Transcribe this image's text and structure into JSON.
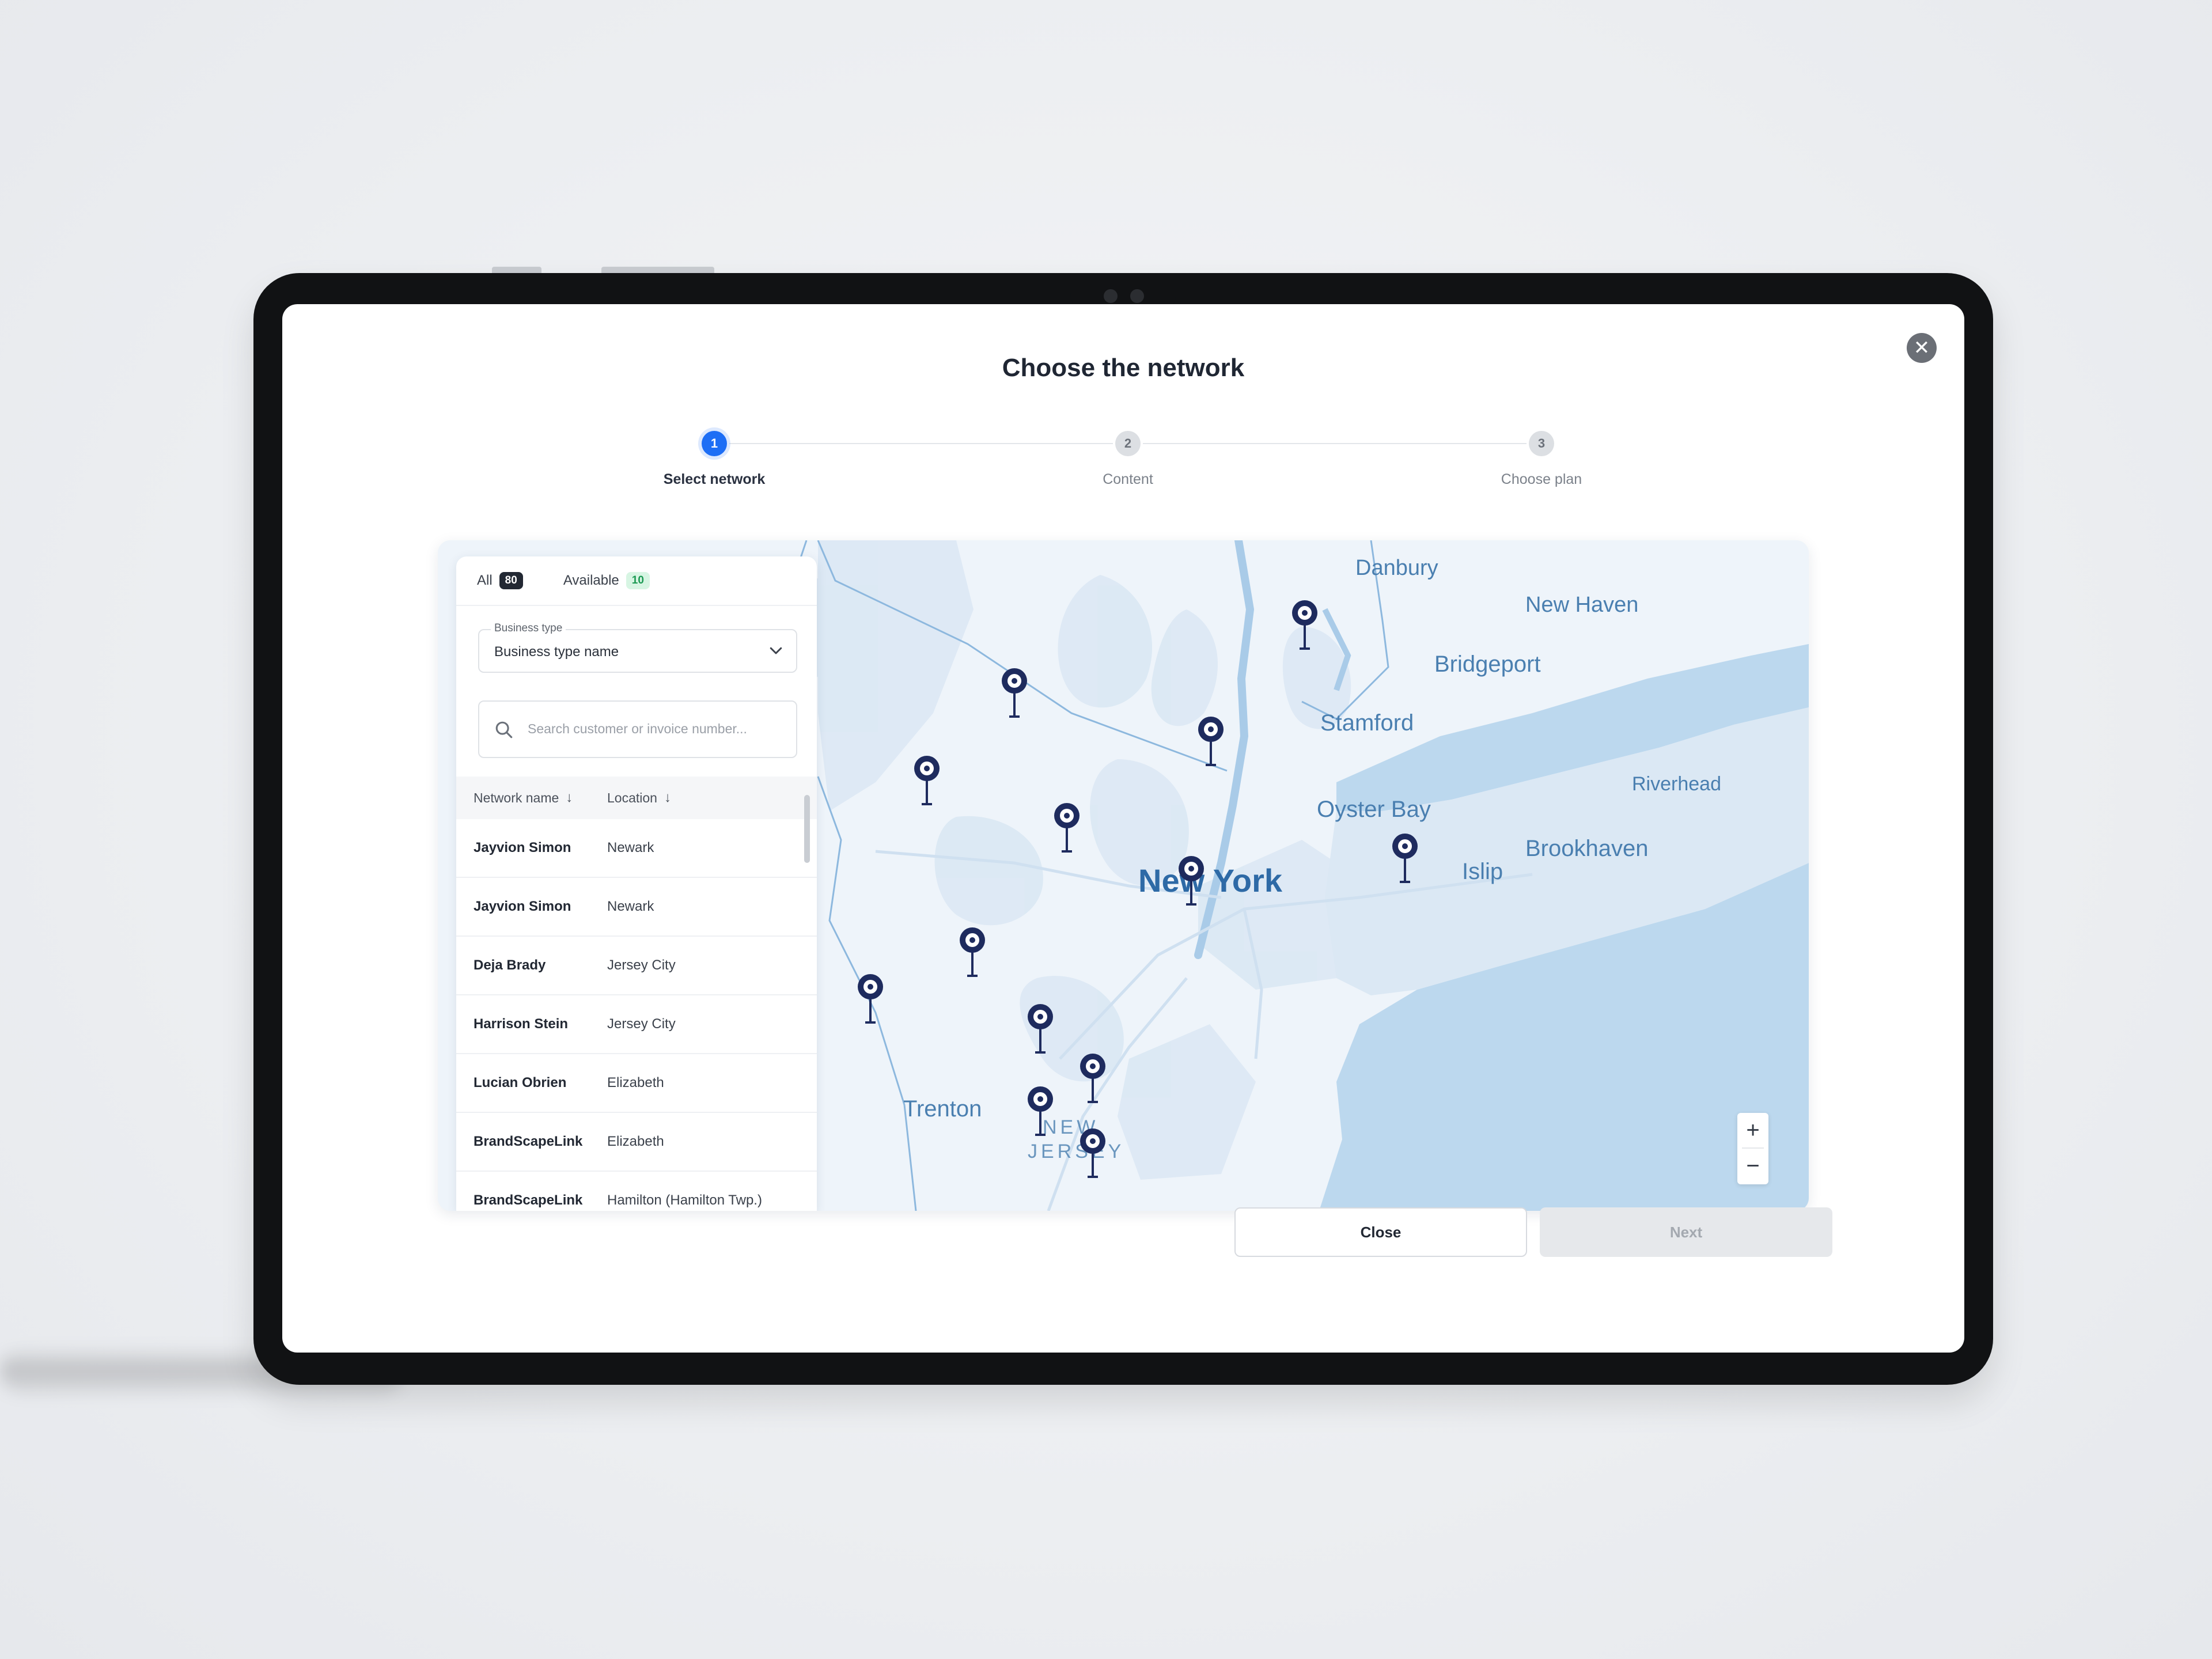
{
  "modal": {
    "title": "Choose the network",
    "close_icon": "close-icon"
  },
  "stepper": {
    "steps": [
      {
        "number": "1",
        "label": "Select network",
        "state": "active"
      },
      {
        "number": "2",
        "label": "Content",
        "state": "idle"
      },
      {
        "number": "3",
        "label": "Choose plan",
        "state": "idle"
      }
    ]
  },
  "filters": {
    "tabs": [
      {
        "label": "All",
        "count": "80"
      },
      {
        "label": "Available",
        "count": "10"
      }
    ],
    "business_type": {
      "label": "Business type",
      "value": "Business type name"
    },
    "search": {
      "placeholder": "Search customer or invoice number..."
    }
  },
  "table": {
    "columns": [
      "Network name",
      "Location"
    ],
    "rows": [
      {
        "name": "Jayvion Simon",
        "location": "Newark"
      },
      {
        "name": "Jayvion Simon",
        "location": "Newark"
      },
      {
        "name": "Deja Brady",
        "location": "Jersey City"
      },
      {
        "name": "Harrison Stein",
        "location": "Jersey City"
      },
      {
        "name": "Lucian Obrien",
        "location": "Elizabeth"
      },
      {
        "name": "BrandScapeLink",
        "location": "Elizabeth"
      },
      {
        "name": "BrandScapeLink",
        "location": "Hamilton (Hamilton Twp.)"
      }
    ]
  },
  "map": {
    "places": {
      "danbury": "Danbury",
      "new_haven": "New Haven",
      "bridgeport": "Bridgeport",
      "stamford": "Stamford",
      "riverhead": "Riverhead",
      "oyster_bay": "Oyster Bay",
      "brookhaven": "Brookhaven",
      "islip": "Islip",
      "new_york": "New York",
      "trenton": "Trenton",
      "new": "NEW",
      "jersey": "JERSEY"
    },
    "zoom_in": "+",
    "zoom_out": "−",
    "colors": {
      "land": "#eef4fa",
      "water": "#bcd8ee",
      "marker": "#1e2b5e",
      "border": "#8db8de"
    }
  },
  "footer": {
    "close_label": "Close",
    "next_label": "Next"
  }
}
